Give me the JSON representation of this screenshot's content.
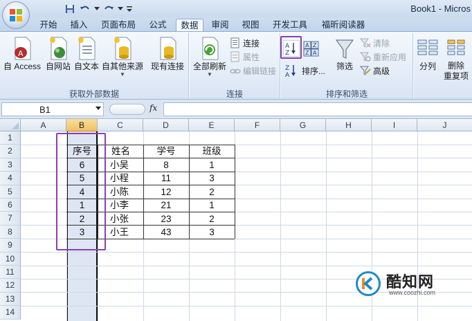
{
  "title": "Book1 - Micros",
  "ribbon_tabs": [
    {
      "label": "开始"
    },
    {
      "label": "插入"
    },
    {
      "label": "页面布局"
    },
    {
      "label": "公式"
    },
    {
      "label": "数据"
    },
    {
      "label": "审阅"
    },
    {
      "label": "视图"
    },
    {
      "label": "开发工具"
    },
    {
      "label": "福昕阅读器"
    }
  ],
  "active_tab": "数据",
  "groups": {
    "external": {
      "label": "获取外部数据",
      "buttons": [
        "自 Access",
        "自网站",
        "自文本",
        "自其他来源",
        "现有连接"
      ]
    },
    "connections": {
      "label": "连接",
      "refresh": "全部刷新",
      "small": [
        "连接",
        "属性",
        "编辑链接"
      ]
    },
    "sort_filter": {
      "label": "排序和筛选",
      "sort": "排序...",
      "filter": "筛选",
      "small": [
        "清除",
        "重新应用",
        "高级"
      ]
    },
    "tools": {
      "split": "分列",
      "remove_dup": "删除\n重复项"
    }
  },
  "formula_bar": {
    "name_box": "B1",
    "fx": "fx",
    "value": ""
  },
  "grid": {
    "columns": [
      "A",
      "B",
      "C",
      "D",
      "E",
      "F",
      "G",
      "H",
      "I",
      "J"
    ],
    "selected_column": "B",
    "rows": [
      "1",
      "2",
      "3",
      "4",
      "5",
      "6",
      "7",
      "8",
      "9",
      "10",
      "11",
      "12",
      "13",
      "14"
    ]
  },
  "table": {
    "headers": [
      "序号",
      "姓名",
      "学号",
      "班级"
    ],
    "rows": [
      [
        "6",
        "小吴",
        "8",
        "1"
      ],
      [
        "5",
        "小程",
        "11",
        "3"
      ],
      [
        "4",
        "小陈",
        "12",
        "2"
      ],
      [
        "1",
        "小李",
        "21",
        "1"
      ],
      [
        "2",
        "小张",
        "23",
        "2"
      ],
      [
        "3",
        "小王",
        "43",
        "3"
      ]
    ]
  },
  "watermark": {
    "name": "酷知网",
    "url": "www.coozhi.com"
  },
  "colors": {
    "highlight": "#8d3fb0",
    "selected_header": "#f1c15f",
    "ribbon": "#dbe7f5"
  }
}
